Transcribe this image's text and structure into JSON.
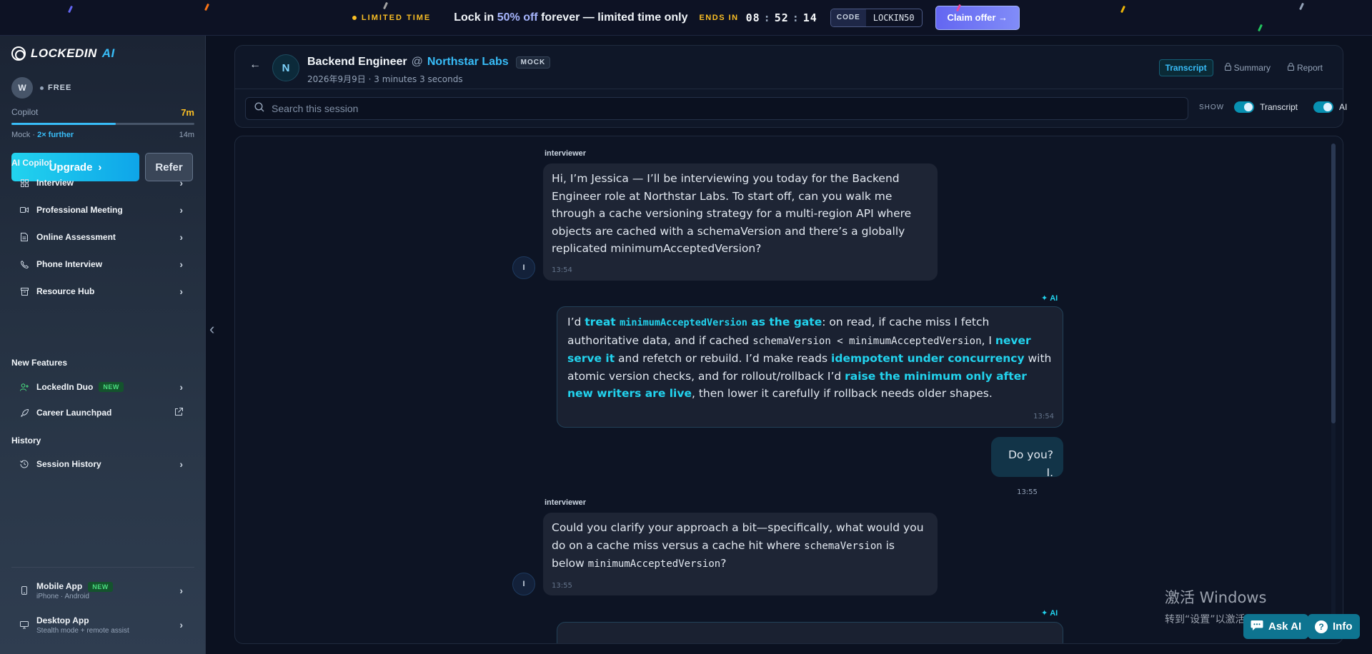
{
  "banner": {
    "tag": "LIMITED TIME",
    "main_prefix": "Lock in",
    "main_highlight": "50% off",
    "main_suffix": "forever — limited time only",
    "ends_label": "ENDS IN",
    "timer_h": "08",
    "timer_m": "52",
    "timer_s": "14",
    "code_label": "CODE",
    "code_value": "LOCKIN50",
    "claim_label": "Claim offer →",
    "colors": {
      "accent": "#6366f1",
      "highlight": "#fbbf24"
    }
  },
  "sidebar": {
    "logo_text": "LOCKEDIN",
    "logo_ai": "AI",
    "avatar_initial": "W",
    "plan": "FREE",
    "copilot_label": "Copilot",
    "copilot_amount": "7m",
    "copilot_progress": 0.57,
    "mock_label": "Mock",
    "mock_sep": "·",
    "mock_further": "2× further",
    "mock_amount": "14m",
    "upgrade_label": "Upgrade",
    "refer_label": "Refer",
    "ai_copilot_title": "AI Copilot",
    "copilot_items": [
      {
        "label": "Interview",
        "icon": "grid-icon"
      },
      {
        "label": "Professional Meeting",
        "icon": "video-icon"
      },
      {
        "label": "Online Assessment",
        "icon": "document-icon"
      },
      {
        "label": "Phone Interview",
        "icon": "phone-icon"
      },
      {
        "label": "Resource Hub",
        "icon": "archive-icon"
      }
    ],
    "new_features_title": "New Features",
    "duo_label": "LockedIn Duo",
    "duo_badge": "NEW",
    "launchpad_label": "Career Launchpad",
    "history_title": "History",
    "session_history_label": "Session History",
    "mobile_label": "Mobile App",
    "mobile_badge": "NEW",
    "mobile_sub": "iPhone · Android",
    "desktop_label": "Desktop App",
    "desktop_sub": "Stealth mode + remote assist"
  },
  "session": {
    "company_initial": "N",
    "role": "Backend Engineer",
    "at": "@",
    "company": "Northstar Labs",
    "mode_badge": "MOCK",
    "meta": "2026年9月9日 · 3 minutes 3 seconds",
    "tabs": [
      {
        "label": "Transcript",
        "active": true
      },
      {
        "label": "Summary",
        "active": false
      },
      {
        "label": "Report",
        "active": false
      }
    ],
    "search_placeholder": "Search this session",
    "show_label": "SHOW",
    "toggle_transcript": "Transcript",
    "toggle_ai": "AI"
  },
  "messages": {
    "m1": {
      "speaker": "interviewer",
      "avatar": "I",
      "text": "Hi, I’m Jessica — I’ll be interviewing you today for the Backend Engineer role at Northstar Labs. To start off, can you walk me through a cache versioning strategy for a multi-region API where objects are cached with a schemaVersion and there’s a globally replicated minimumAcceptedVersion?",
      "time": "13:54"
    },
    "m2": {
      "tag": "AI",
      "p1": "I’d ",
      "h1a": "treat ",
      "h1code": "minimumAcceptedVersion",
      "h1b": " as the gate",
      "p2": ": on read, if cache miss I fetch authoritative data, and if cached ",
      "code1": "schemaVersion < minimumAcceptedVersion",
      "p3": ", I ",
      "h2": "never serve it",
      "p4": " and refetch or rebuild. I’d make reads ",
      "h3": "idempotent under concurrency",
      "p5": " with atomic version checks, and for rollout/rollback I’d ",
      "h4": "raise the minimum only after new writers are live",
      "p6": ", then lower it carefully if rollback needs older shapes.",
      "time": "13:54"
    },
    "m3": {
      "text": "Do you? I.",
      "time": "13:55"
    },
    "m4": {
      "speaker": "interviewer",
      "avatar": "I",
      "p1": "Could you clarify your approach a bit—specifically, what would you do on a cache miss versus a cache hit where ",
      "code1": "schemaVersion",
      "p2": " is below ",
      "code2": "minimumAcceptedVersion",
      "p3": "?",
      "time": "13:55"
    },
    "m5": {
      "tag": "AI"
    }
  },
  "watermark": {
    "line1": "激活 Windows",
    "line2": "转到“设置”以激活 Windows。"
  },
  "floating": {
    "ask_ai": "Ask AI",
    "info": "Info",
    "info_icon": "?"
  }
}
